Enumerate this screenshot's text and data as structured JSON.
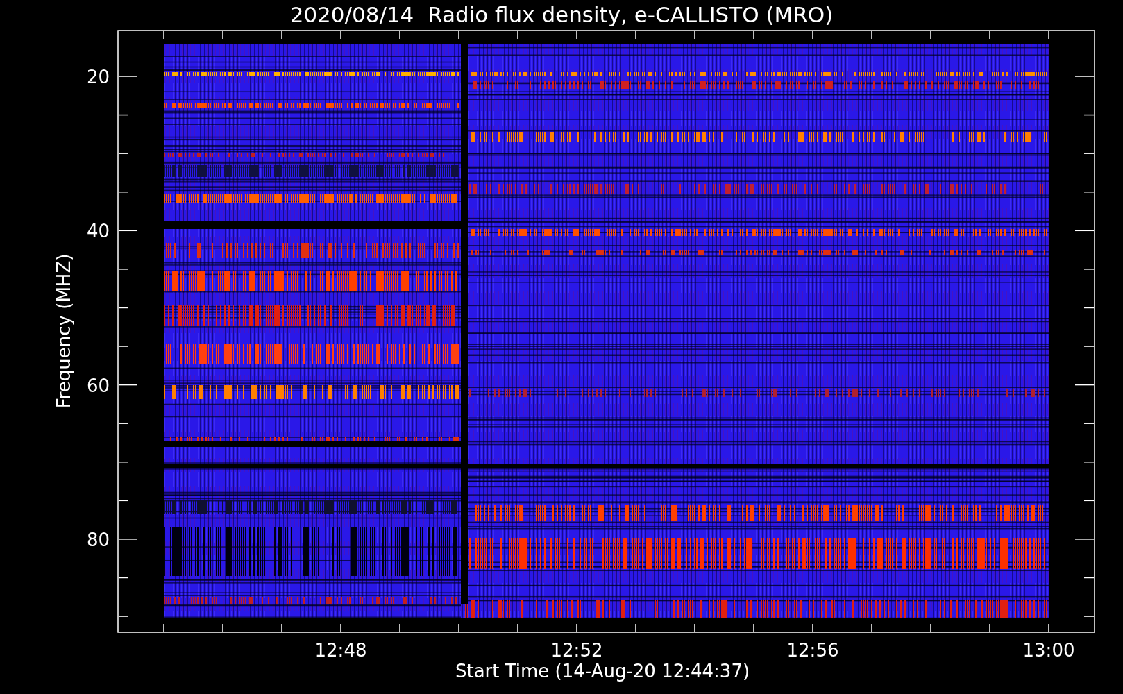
{
  "plot": {
    "title": "2020/08/14  Radio flux density, e-CALLISTO (MRO)",
    "xlabel": "Start Time (14-Aug-20 12:44:37)",
    "ylabel": "Frequency (MHZ)",
    "xticks": [
      "12:48",
      "12:52",
      "12:56",
      "13:00"
    ],
    "yticks": [
      "20",
      "40",
      "60",
      "80"
    ]
  }
}
